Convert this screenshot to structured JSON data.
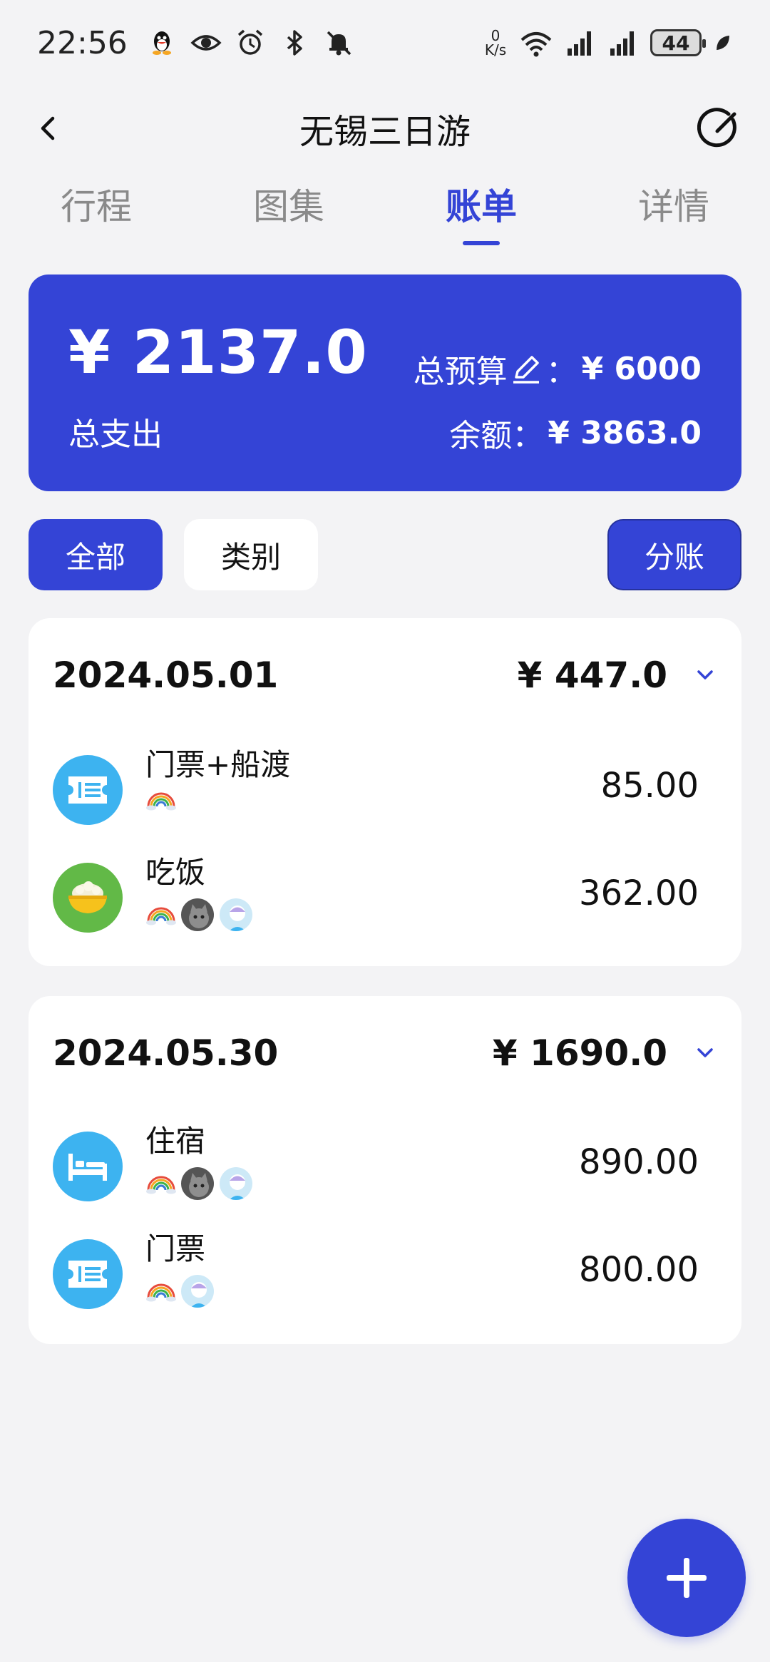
{
  "status": {
    "time": "22:56",
    "net_speed_value": "0",
    "net_speed_unit": "K/s",
    "battery": "44"
  },
  "header": {
    "title": "无锡三日游"
  },
  "tabs": [
    {
      "label": "行程",
      "active": false
    },
    {
      "label": "图集",
      "active": false
    },
    {
      "label": "账单",
      "active": true
    },
    {
      "label": "详情",
      "active": false
    }
  ],
  "summary": {
    "total": "¥ 2137.0",
    "total_label": "总支出",
    "budget_label": "总预算",
    "budget_sep": "：",
    "budget_value": "¥ 6000",
    "balance_label": "余额：",
    "balance_value": "¥ 3863.0"
  },
  "filters": {
    "all": "全部",
    "category": "类别",
    "split": "分账"
  },
  "days": [
    {
      "date": "2024.05.01",
      "total": "¥ 447.0",
      "entries": [
        {
          "name": "门票+船渡",
          "amount": "85.00",
          "icon": "ticket-icon"
        },
        {
          "name": "吃饭",
          "amount": "362.00",
          "icon": "rice-bowl-icon"
        }
      ]
    },
    {
      "date": "2024.05.30",
      "total": "¥ 1690.0",
      "entries": [
        {
          "name": "住宿",
          "amount": "890.00",
          "icon": "bed-icon"
        },
        {
          "name": "门票",
          "amount": "800.00",
          "icon": "ticket-icon"
        }
      ]
    }
  ],
  "colors": {
    "accent": "#3444d6",
    "icon_blue": "#3db3f0",
    "icon_green": "#62b947",
    "background": "#f3f3f5"
  }
}
